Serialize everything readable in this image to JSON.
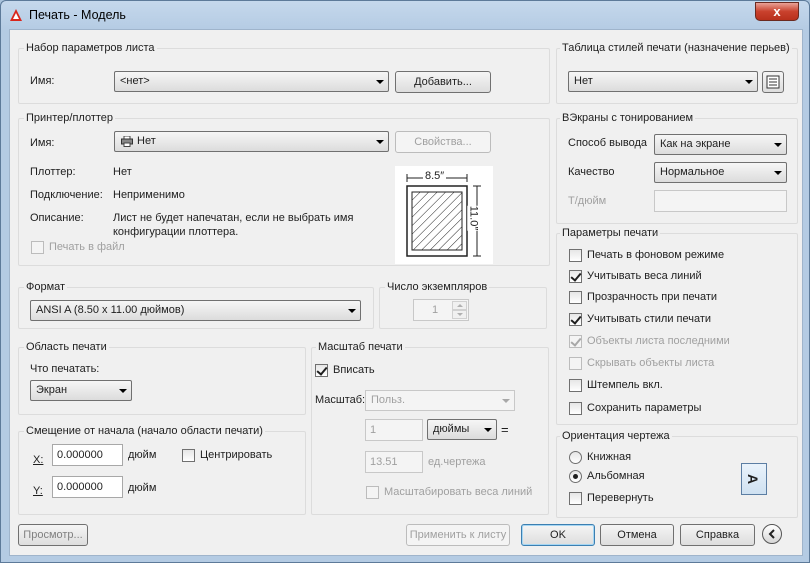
{
  "window": {
    "title": "Печать - Модель",
    "close": "x"
  },
  "page_setup": {
    "title": "Набор параметров листа",
    "name_label": "Имя:",
    "name_value": "<нет>",
    "add_button": "Добавить..."
  },
  "printer": {
    "title": "Принтер/плоттер",
    "name_label": "Имя:",
    "name_value": "Нет",
    "properties_button": "Свойства...",
    "plotter_label": "Плоттер:",
    "plotter_value": "Нет",
    "connection_label": "Подключение:",
    "connection_value": "Неприменимо",
    "description_label": "Описание:",
    "description_line1": "Лист не будет напечатан, если не выбрать имя",
    "description_line2": "конфигурации плоттера.",
    "print_to_file": "Печать в файл",
    "paper_width": "8.5″",
    "paper_height": "11.0″"
  },
  "format": {
    "title": "Формат",
    "value": "ANSI A (8.50 x 11.00 дюймов)"
  },
  "copies": {
    "title": "Число экземпляров",
    "value": "1"
  },
  "plot_area": {
    "title": "Область печати",
    "what_label": "Что печатать:",
    "what_value": "Экран"
  },
  "offset": {
    "title": "Смещение от начала (начало области печати)",
    "x_label": "X:",
    "x_value": "0.000000",
    "x_unit": "дюйм",
    "y_label": "Y:",
    "y_value": "0.000000",
    "y_unit": "дюйм",
    "center_label": "Центрировать"
  },
  "scale": {
    "title": "Масштаб печати",
    "fit_label": "Вписать",
    "scale_label": "Масштаб:",
    "scale_value": "Польз.",
    "value1": "1",
    "unit_value": "дюймы",
    "equals": "=",
    "value2": "13.51",
    "unit2": "ед.чертежа",
    "scale_lineweights": "Масштабировать веса линий"
  },
  "plot_style": {
    "title": "Таблица стилей печати (назначение перьев)",
    "value": "Нет"
  },
  "shaded": {
    "title": "ВЭкраны с тонированием",
    "mode_label": "Способ вывода",
    "mode_value": "Как на экране",
    "quality_label": "Качество",
    "quality_value": "Нормальное",
    "dpi_label": "Т/дюйм"
  },
  "options": {
    "title": "Параметры печати",
    "items": [
      {
        "label": "Печать в фоновом режиме",
        "checked": false,
        "disabled": false
      },
      {
        "label": "Учитывать веса линий",
        "checked": true,
        "disabled": false
      },
      {
        "label": "Прозрачность при печати",
        "checked": false,
        "disabled": false
      },
      {
        "label": "Учитывать стили печати",
        "checked": true,
        "disabled": false
      },
      {
        "label": "Объекты листа последними",
        "checked": true,
        "disabled": true
      },
      {
        "label": "Скрывать объекты листа",
        "checked": false,
        "disabled": true
      },
      {
        "label": "Штемпель вкл.",
        "checked": false,
        "disabled": false
      },
      {
        "label": "Сохранить параметры",
        "checked": false,
        "disabled": false
      }
    ]
  },
  "orientation": {
    "title": "Ориентация чертежа",
    "portrait": "Книжная",
    "landscape": "Альбомная",
    "upside_down": "Перевернуть",
    "icon_letter": "A"
  },
  "footer": {
    "preview": "Просмотр...",
    "apply": "Применить к листу",
    "ok": "OK",
    "cancel": "Отмена",
    "help": "Справка"
  }
}
